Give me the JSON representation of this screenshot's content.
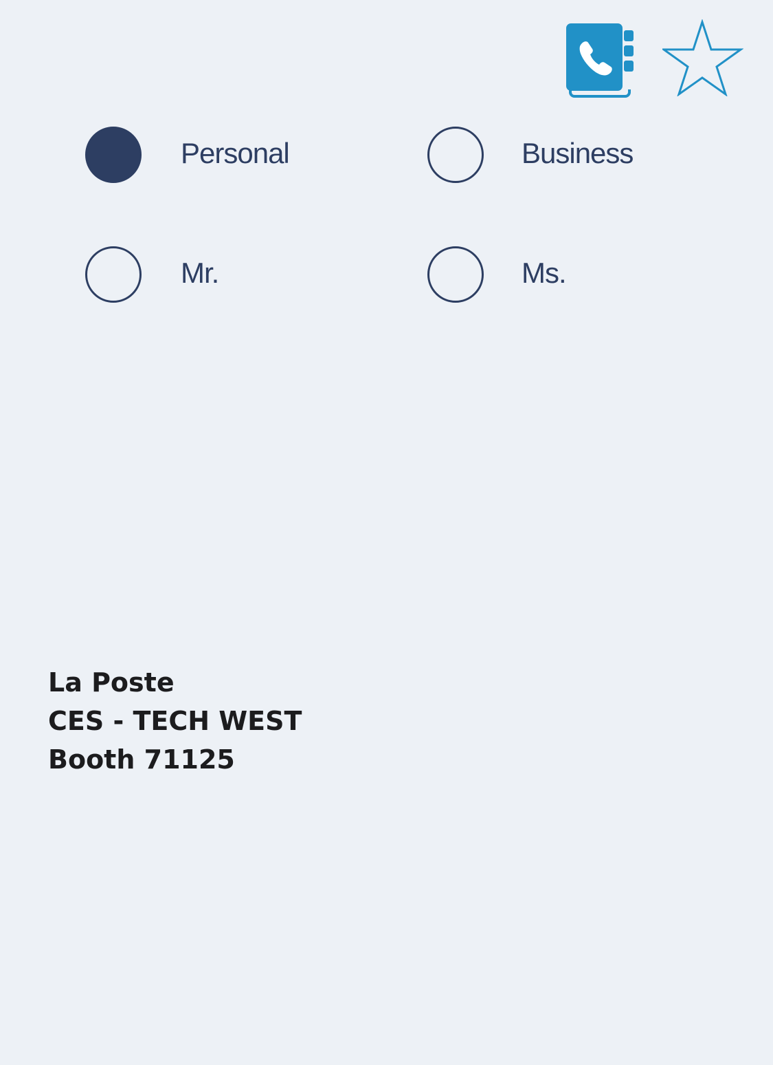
{
  "toolbar": {
    "contacts_icon": "contact-book-phone-icon",
    "favorite_icon": "star-outline-icon",
    "accent_color": "#2191c7"
  },
  "account_type": {
    "options": [
      {
        "label": "Personal",
        "checked": true
      },
      {
        "label": "Business",
        "checked": false
      }
    ]
  },
  "salutation": {
    "options": [
      {
        "label": "Mr.",
        "checked": false
      },
      {
        "label": "Ms.",
        "checked": false
      }
    ]
  },
  "address": {
    "lines": [
      "La Poste",
      "CES - TECH WEST",
      "Booth 71125"
    ]
  },
  "colors": {
    "background": "#edf1f6",
    "radio": "#2d3e62",
    "text_dark": "#1c1c1e"
  }
}
